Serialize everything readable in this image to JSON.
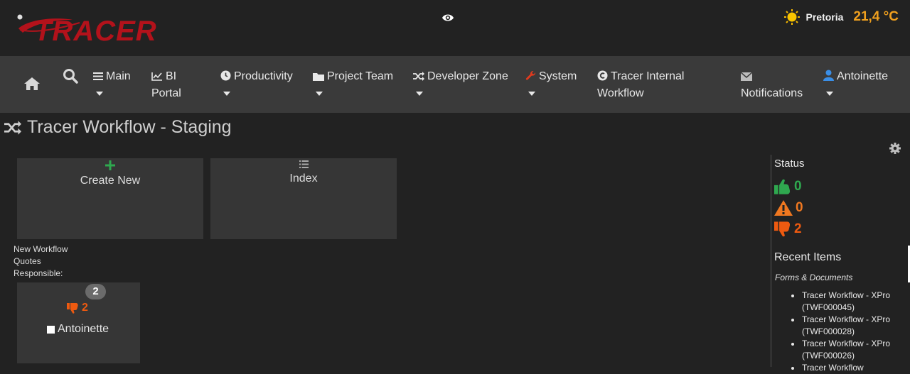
{
  "header": {
    "logo_text": "TRACER",
    "weather": {
      "city": "Pretoria",
      "temperature": "21,4  °C",
      "icon": "sun-icon"
    },
    "eye_icon": "eye-icon"
  },
  "nav": {
    "home_icon": "home-icon",
    "search_icon": "search-icon",
    "items": [
      {
        "label": "Main",
        "icon": "bars-icon"
      },
      {
        "label": "BI",
        "label2": "Portal",
        "icon": "chart-icon"
      },
      {
        "label": "Productivity",
        "icon": "clock-icon"
      },
      {
        "label": "Project Team",
        "icon": "folder-icon"
      },
      {
        "label": "Developer Zone",
        "icon": "shuffle-icon"
      },
      {
        "label": "System",
        "icon": "wrench-icon"
      },
      {
        "label": "Tracer Internal",
        "label2": "Workflow",
        "icon": "circle-icon"
      },
      {
        "label": "Notifications",
        "icon": "envelope-icon"
      },
      {
        "label": "Antoinette",
        "icon": "user-icon"
      }
    ]
  },
  "page": {
    "title": "Tracer Workflow - Staging"
  },
  "tiles": {
    "create_new": "Create New",
    "index": "Index"
  },
  "info": {
    "line1": "New Workflow",
    "line2": "Quotes",
    "line3": "Responsible:"
  },
  "person": {
    "badge": "2",
    "thumbs_down_count": "2",
    "name": "Antoinette"
  },
  "sidebar": {
    "status_title": "Status",
    "thumbs_up": "0",
    "warning": "0",
    "thumbs_down": "2",
    "recent_title": "Recent Items",
    "forms_label": "Forms & Documents",
    "recent_items": [
      {
        "title": "Tracer Workflow - XPro",
        "code": "(TWF000045)"
      },
      {
        "title": "Tracer Workflow - XPro",
        "code": "(TWF000028)"
      },
      {
        "title": "Tracer Workflow - XPro",
        "code": "(TWF000026)"
      },
      {
        "title": "Tracer Workflow"
      }
    ]
  },
  "colors": {
    "green": "#2fa84f",
    "orange": "#f07820",
    "red_orange": "#ee5a10",
    "brand_red": "#b3121b"
  }
}
